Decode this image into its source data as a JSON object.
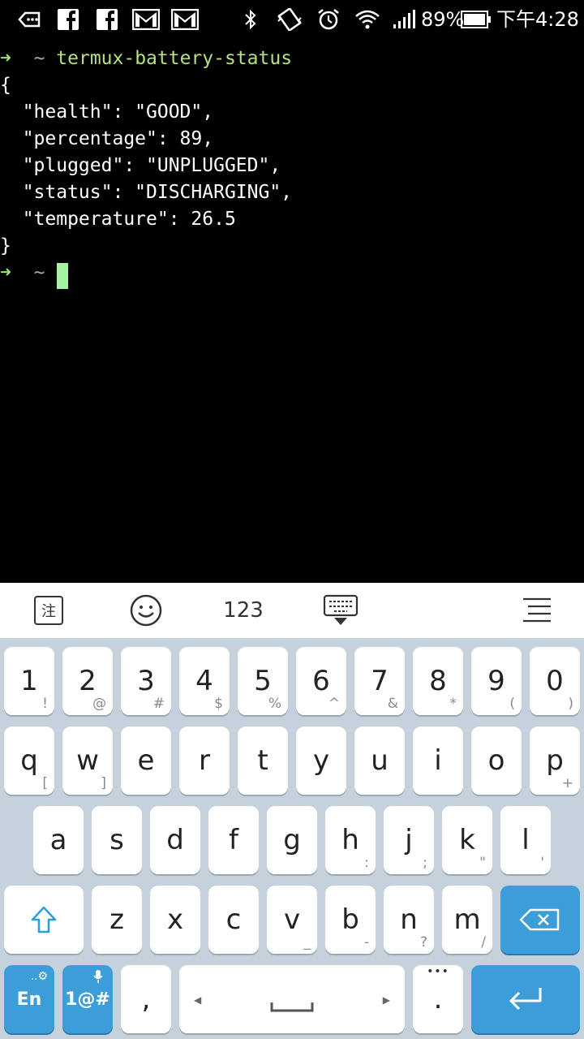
{
  "status_bar": {
    "battery_percent": "89%",
    "time": "下午4:28",
    "icons": [
      "voicemail-icon",
      "facebook-icon",
      "facebook-icon",
      "gmail-icon",
      "gmail-icon",
      "bluetooth-icon",
      "vibrate-icon",
      "alarm-icon",
      "wifi-icon",
      "signal-icon",
      "battery-icon"
    ]
  },
  "terminal": {
    "prompt_arrow": "➜",
    "prompt_tilde": "~",
    "command": "termux-battery-status",
    "output_lines": [
      "{",
      "  \"health\": \"GOOD\",",
      "  \"percentage\": 89,",
      "  \"plugged\": \"UNPLUGGED\",",
      "  \"status\": \"DISCHARGING\",",
      "  \"temperature\": 26.5",
      "}"
    ]
  },
  "keyboard_toolbar": {
    "annotate_label": "注",
    "numbers_label": "123"
  },
  "keyboard": {
    "number_row": [
      {
        "main": "1",
        "sub": "!"
      },
      {
        "main": "2",
        "sub": "@"
      },
      {
        "main": "3",
        "sub": "#"
      },
      {
        "main": "4",
        "sub": "$"
      },
      {
        "main": "5",
        "sub": "%"
      },
      {
        "main": "6",
        "sub": "^"
      },
      {
        "main": "7",
        "sub": "&"
      },
      {
        "main": "8",
        "sub": "*"
      },
      {
        "main": "9",
        "sub": "("
      },
      {
        "main": "0",
        "sub": ")"
      }
    ],
    "row1": [
      {
        "main": "q",
        "sub": "["
      },
      {
        "main": "w",
        "sub": "]"
      },
      {
        "main": "e",
        "sub": ""
      },
      {
        "main": "r",
        "sub": ""
      },
      {
        "main": "t",
        "sub": ""
      },
      {
        "main": "y",
        "sub": ""
      },
      {
        "main": "u",
        "sub": ""
      },
      {
        "main": "i",
        "sub": ""
      },
      {
        "main": "o",
        "sub": ""
      },
      {
        "main": "p",
        "sub": "+"
      }
    ],
    "row2": [
      {
        "main": "a",
        "sub": ""
      },
      {
        "main": "s",
        "sub": ""
      },
      {
        "main": "d",
        "sub": ""
      },
      {
        "main": "f",
        "sub": ""
      },
      {
        "main": "g",
        "sub": ""
      },
      {
        "main": "h",
        "sub": ":"
      },
      {
        "main": "j",
        "sub": ";"
      },
      {
        "main": "k",
        "sub": "\""
      },
      {
        "main": "l",
        "sub": "'"
      }
    ],
    "row3": [
      {
        "main": "z",
        "sub": ""
      },
      {
        "main": "x",
        "sub": ""
      },
      {
        "main": "c",
        "sub": ""
      },
      {
        "main": "v",
        "sub": "_"
      },
      {
        "main": "b",
        "sub": "-"
      },
      {
        "main": "n",
        "sub": "?"
      },
      {
        "main": "m",
        "sub": "/"
      }
    ],
    "lang_label": "En",
    "symbols_label": "1@#",
    "comma_label": ",",
    "period_label": ".",
    "more_label": "•••",
    "accent_color": "#3d9dd9"
  }
}
